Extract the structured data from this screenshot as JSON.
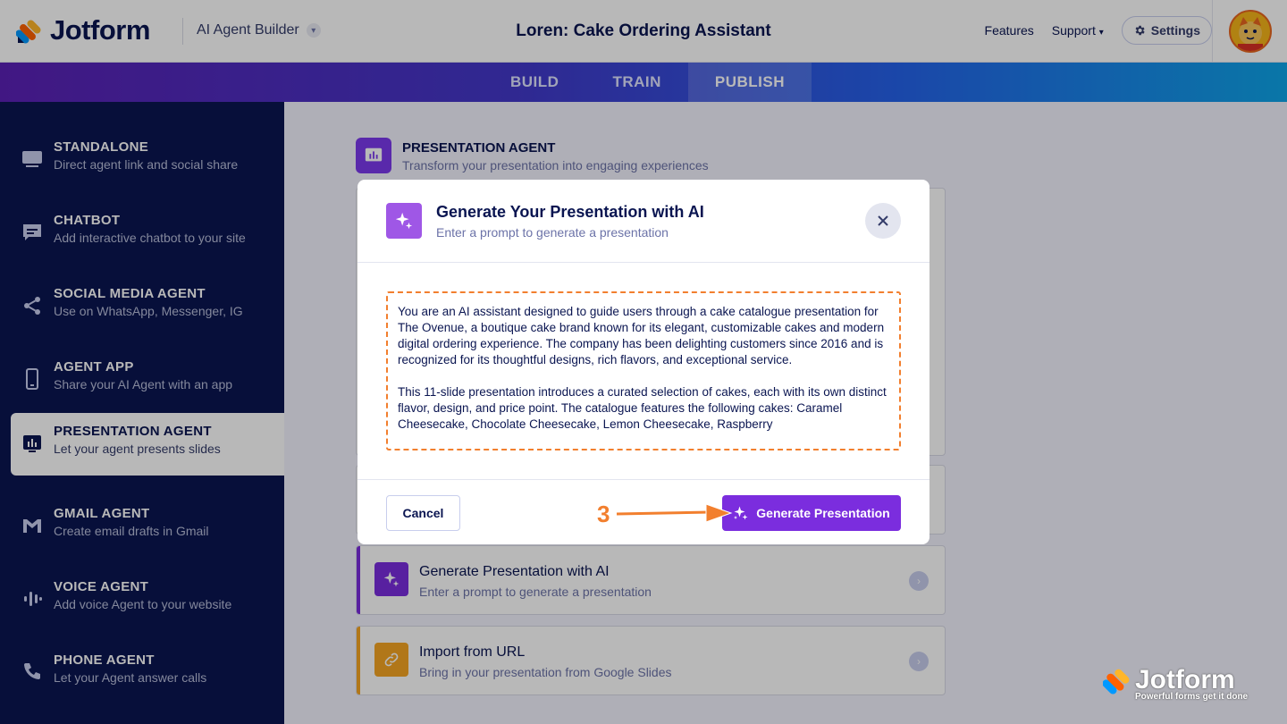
{
  "header": {
    "logo_text": "Jotform",
    "builder_label": "AI Agent Builder",
    "title": "Loren: Cake Ordering Assistant",
    "nav": {
      "features": "Features",
      "support": "Support",
      "settings": "Settings"
    }
  },
  "tabs": [
    {
      "label": "BUILD"
    },
    {
      "label": "TRAIN"
    },
    {
      "label": "PUBLISH"
    }
  ],
  "sidebar": {
    "items": [
      {
        "title": "STANDALONE",
        "sub": "Direct agent link and social share"
      },
      {
        "title": "CHATBOT",
        "sub": "Add interactive chatbot to your site"
      },
      {
        "title": "SOCIAL MEDIA AGENT",
        "sub": "Use on WhatsApp, Messenger, IG"
      },
      {
        "title": "AGENT APP",
        "sub": "Share your AI Agent with an app"
      },
      {
        "title": "PRESENTATION AGENT",
        "sub": "Let your agent presents slides"
      },
      {
        "title": "GMAIL AGENT",
        "sub": "Create email drafts in Gmail"
      },
      {
        "title": "VOICE AGENT",
        "sub": "Add voice Agent to your website"
      },
      {
        "title": "PHONE AGENT",
        "sub": "Let your Agent answer calls"
      }
    ]
  },
  "main": {
    "title": "PRESENTATION AGENT",
    "subtitle": "Transform your presentation into engaging experiences",
    "options": [
      {
        "title": "Generate Presentation with AI",
        "sub": "Enter a prompt to generate a presentation"
      },
      {
        "title": "Import from URL",
        "sub": "Bring in your presentation from Google Slides"
      }
    ]
  },
  "modal": {
    "title": "Generate Your Presentation with AI",
    "subtitle": "Enter a prompt to generate a presentation",
    "prompt_p1": "You are an AI assistant designed to guide users through a cake catalogue presentation for The Ovenue, a boutique cake brand known for its elegant, customizable cakes and modern digital ordering experience. The company has been delighting customers since 2016 and is recognized for its thoughtful designs, rich flavors, and exceptional service.",
    "prompt_p2": "This 11-slide presentation introduces a curated selection of cakes, each with its own distinct flavor, design, and price point. The catalogue features the following cakes: Caramel Cheesecake, Chocolate Cheesecake, Lemon Cheesecake, Raspberry",
    "cancel_label": "Cancel",
    "generate_label": "Generate Presentation"
  },
  "annotation": {
    "step": "3"
  },
  "watermark": {
    "text": "Jotform",
    "tagline": "Powerful forms get it done"
  },
  "colors": {
    "accent": "#7b2dde",
    "navy": "#0a1551",
    "orange": "#f27f2e"
  }
}
